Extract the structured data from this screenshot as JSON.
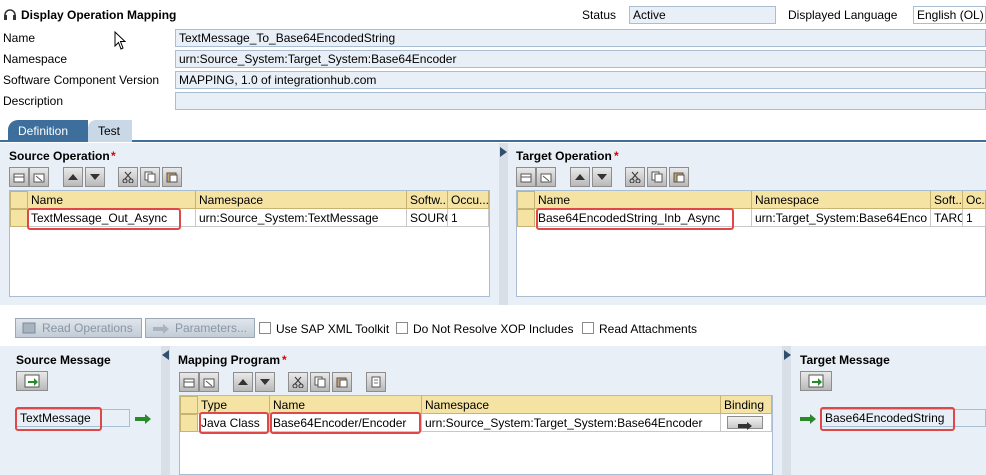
{
  "header": {
    "title": "Display Operation Mapping",
    "status_label": "Status",
    "status_value": "Active",
    "language_label": "Displayed Language",
    "language_value": "English (OL)"
  },
  "form": {
    "name_label": "Name",
    "name_value": "TextMessage_To_Base64EncodedString",
    "namespace_label": "Namespace",
    "namespace_value": "urn:Source_System:Target_System:Base64Encoder",
    "swcv_label": "Software Component Version",
    "swcv_value": "MAPPING, 1.0 of integrationhub.com",
    "description_label": "Description",
    "description_value": ""
  },
  "tabs": [
    {
      "label": "Definition",
      "active": true
    },
    {
      "label": "Test",
      "active": false
    }
  ],
  "source_operation": {
    "title": "Source Operation",
    "required_mark": "*",
    "columns": [
      "Name",
      "Namespace",
      "Softw...",
      "Occu..."
    ],
    "rows": [
      [
        "TextMessage_Out_Async",
        "urn:Source_System:TextMessage",
        "SOURC",
        "1"
      ]
    ]
  },
  "target_operation": {
    "title": "Target Operation",
    "required_mark": "*",
    "columns": [
      "Name",
      "Namespace",
      "Soft...",
      "Oc..."
    ],
    "rows": [
      [
        "Base64EncodedString_Inb_Async",
        "urn:Target_System:Base64Enco",
        "TARG",
        "1"
      ]
    ]
  },
  "actions": {
    "read_operations": "Read Operations",
    "parameters": "Parameters...",
    "use_sap_xml_toolkit": "Use SAP XML Toolkit",
    "do_not_resolve_xop": "Do Not Resolve XOP Includes",
    "read_attachments": "Read Attachments"
  },
  "source_message": {
    "title": "Source Message",
    "value": "TextMessage"
  },
  "mapping_program": {
    "title": "Mapping Program",
    "required_mark": "*",
    "columns": [
      "Type",
      "Name",
      "Namespace",
      "Binding"
    ],
    "rows": [
      [
        "Java Class",
        "Base64Encoder/Encoder",
        "urn:Source_System:Target_System:Base64Encoder",
        ""
      ]
    ]
  },
  "target_message": {
    "title": "Target Message",
    "value": "Base64EncodedString"
  },
  "colors": {
    "panel": "#e8eff6",
    "header_cell": "#f4e3a3",
    "highlight": "#e04848",
    "tab_active": "#3d6e9c"
  }
}
